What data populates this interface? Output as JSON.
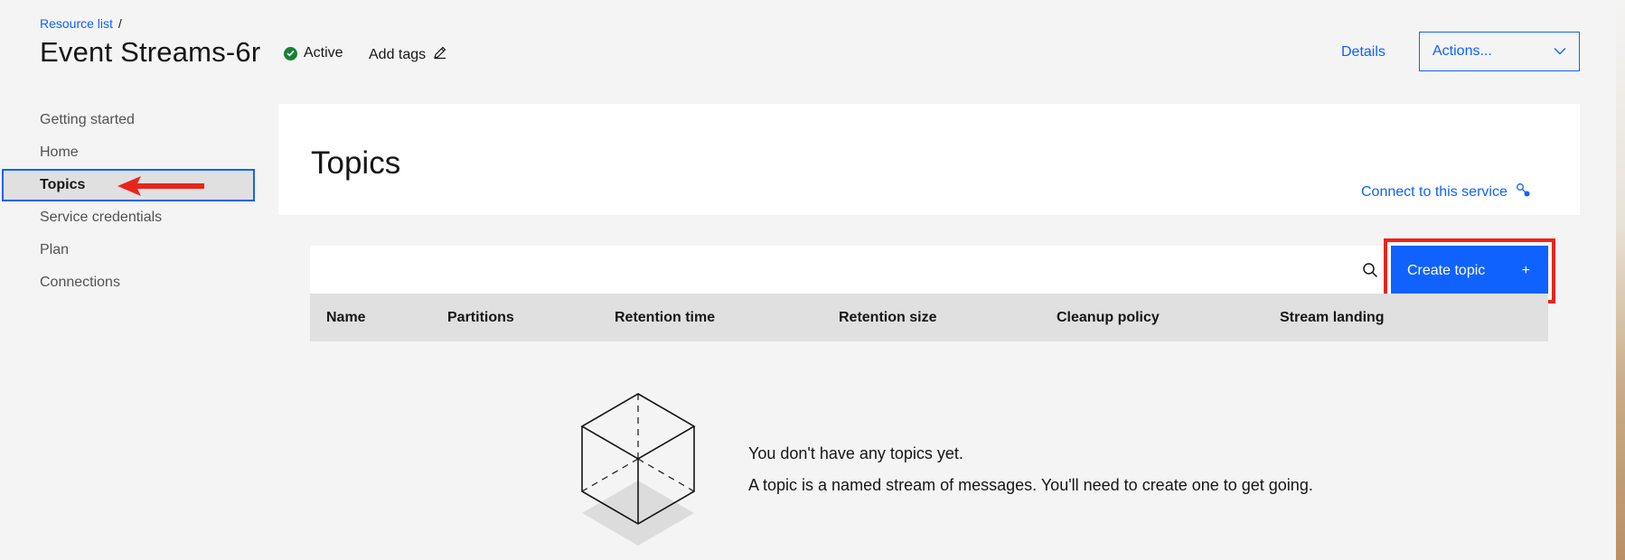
{
  "header": {
    "breadcrumb": {
      "link": "Resource list",
      "separator": "/"
    },
    "title": "Event Streams-6r",
    "status": "Active",
    "add_tags": "Add tags",
    "details": "Details",
    "actions": "Actions..."
  },
  "sidebar": {
    "items": [
      {
        "label": "Getting started"
      },
      {
        "label": "Home"
      },
      {
        "label": "Topics"
      },
      {
        "label": "Service credentials"
      },
      {
        "label": "Plan"
      },
      {
        "label": "Connections"
      }
    ],
    "active_item": "Topics"
  },
  "main": {
    "title": "Topics",
    "connect_link": "Connect to this service",
    "create_button": "Create topic",
    "create_icon": "+",
    "table": {
      "columns": [
        "Name",
        "Partitions",
        "Retention time",
        "Retention size",
        "Cleanup policy",
        "Stream landing"
      ]
    },
    "empty_state": {
      "title": "You don't have any topics yet.",
      "description": "A topic is a named stream of messages. You'll need to create one to get going."
    }
  },
  "colors": {
    "accent": "#0f62fe",
    "success": "#198038",
    "annotation": "#e8251b",
    "background": "#f4f4f4"
  },
  "icons": [
    "check-icon",
    "edit-icon",
    "chevron-down-icon",
    "search-icon",
    "plus-icon",
    "connect-icon",
    "cube-illustration-icon",
    "annotation-arrow-icon"
  ]
}
